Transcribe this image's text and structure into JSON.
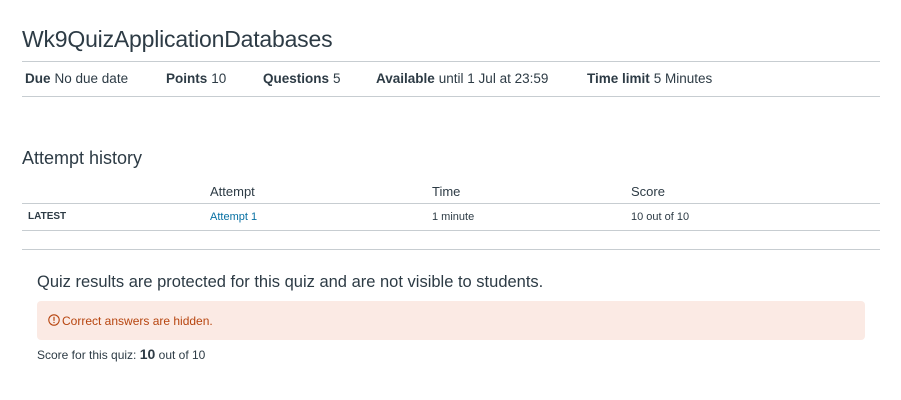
{
  "quiz": {
    "title": "Wk9QuizApplicationDatabases"
  },
  "details": {
    "due_label": "Due",
    "due_value": "No due date",
    "points_label": "Points",
    "points_value": "10",
    "questions_label": "Questions",
    "questions_value": "5",
    "available_label": "Available",
    "available_value": "until 1 Jul at 23:59",
    "time_limit_label": "Time limit",
    "time_limit_value": "5 Minutes"
  },
  "history": {
    "title": "Attempt history",
    "headers": {
      "attempt": "Attempt",
      "time": "Time",
      "score": "Score"
    },
    "rows": [
      {
        "tag": "LATEST",
        "attempt": "Attempt 1",
        "time": "1 minute",
        "score": "10 out of 10"
      }
    ]
  },
  "results": {
    "protected_message": "Quiz results are protected for this quiz and are not visible to students.",
    "alert_text": "Correct answers are hidden.",
    "score_label": "Score for this quiz:",
    "score_value": "10",
    "score_suffix": "out of 10"
  },
  "colors": {
    "link": "#0770a3",
    "alert_bg": "#fbeae4",
    "alert_text": "#b7450f"
  }
}
